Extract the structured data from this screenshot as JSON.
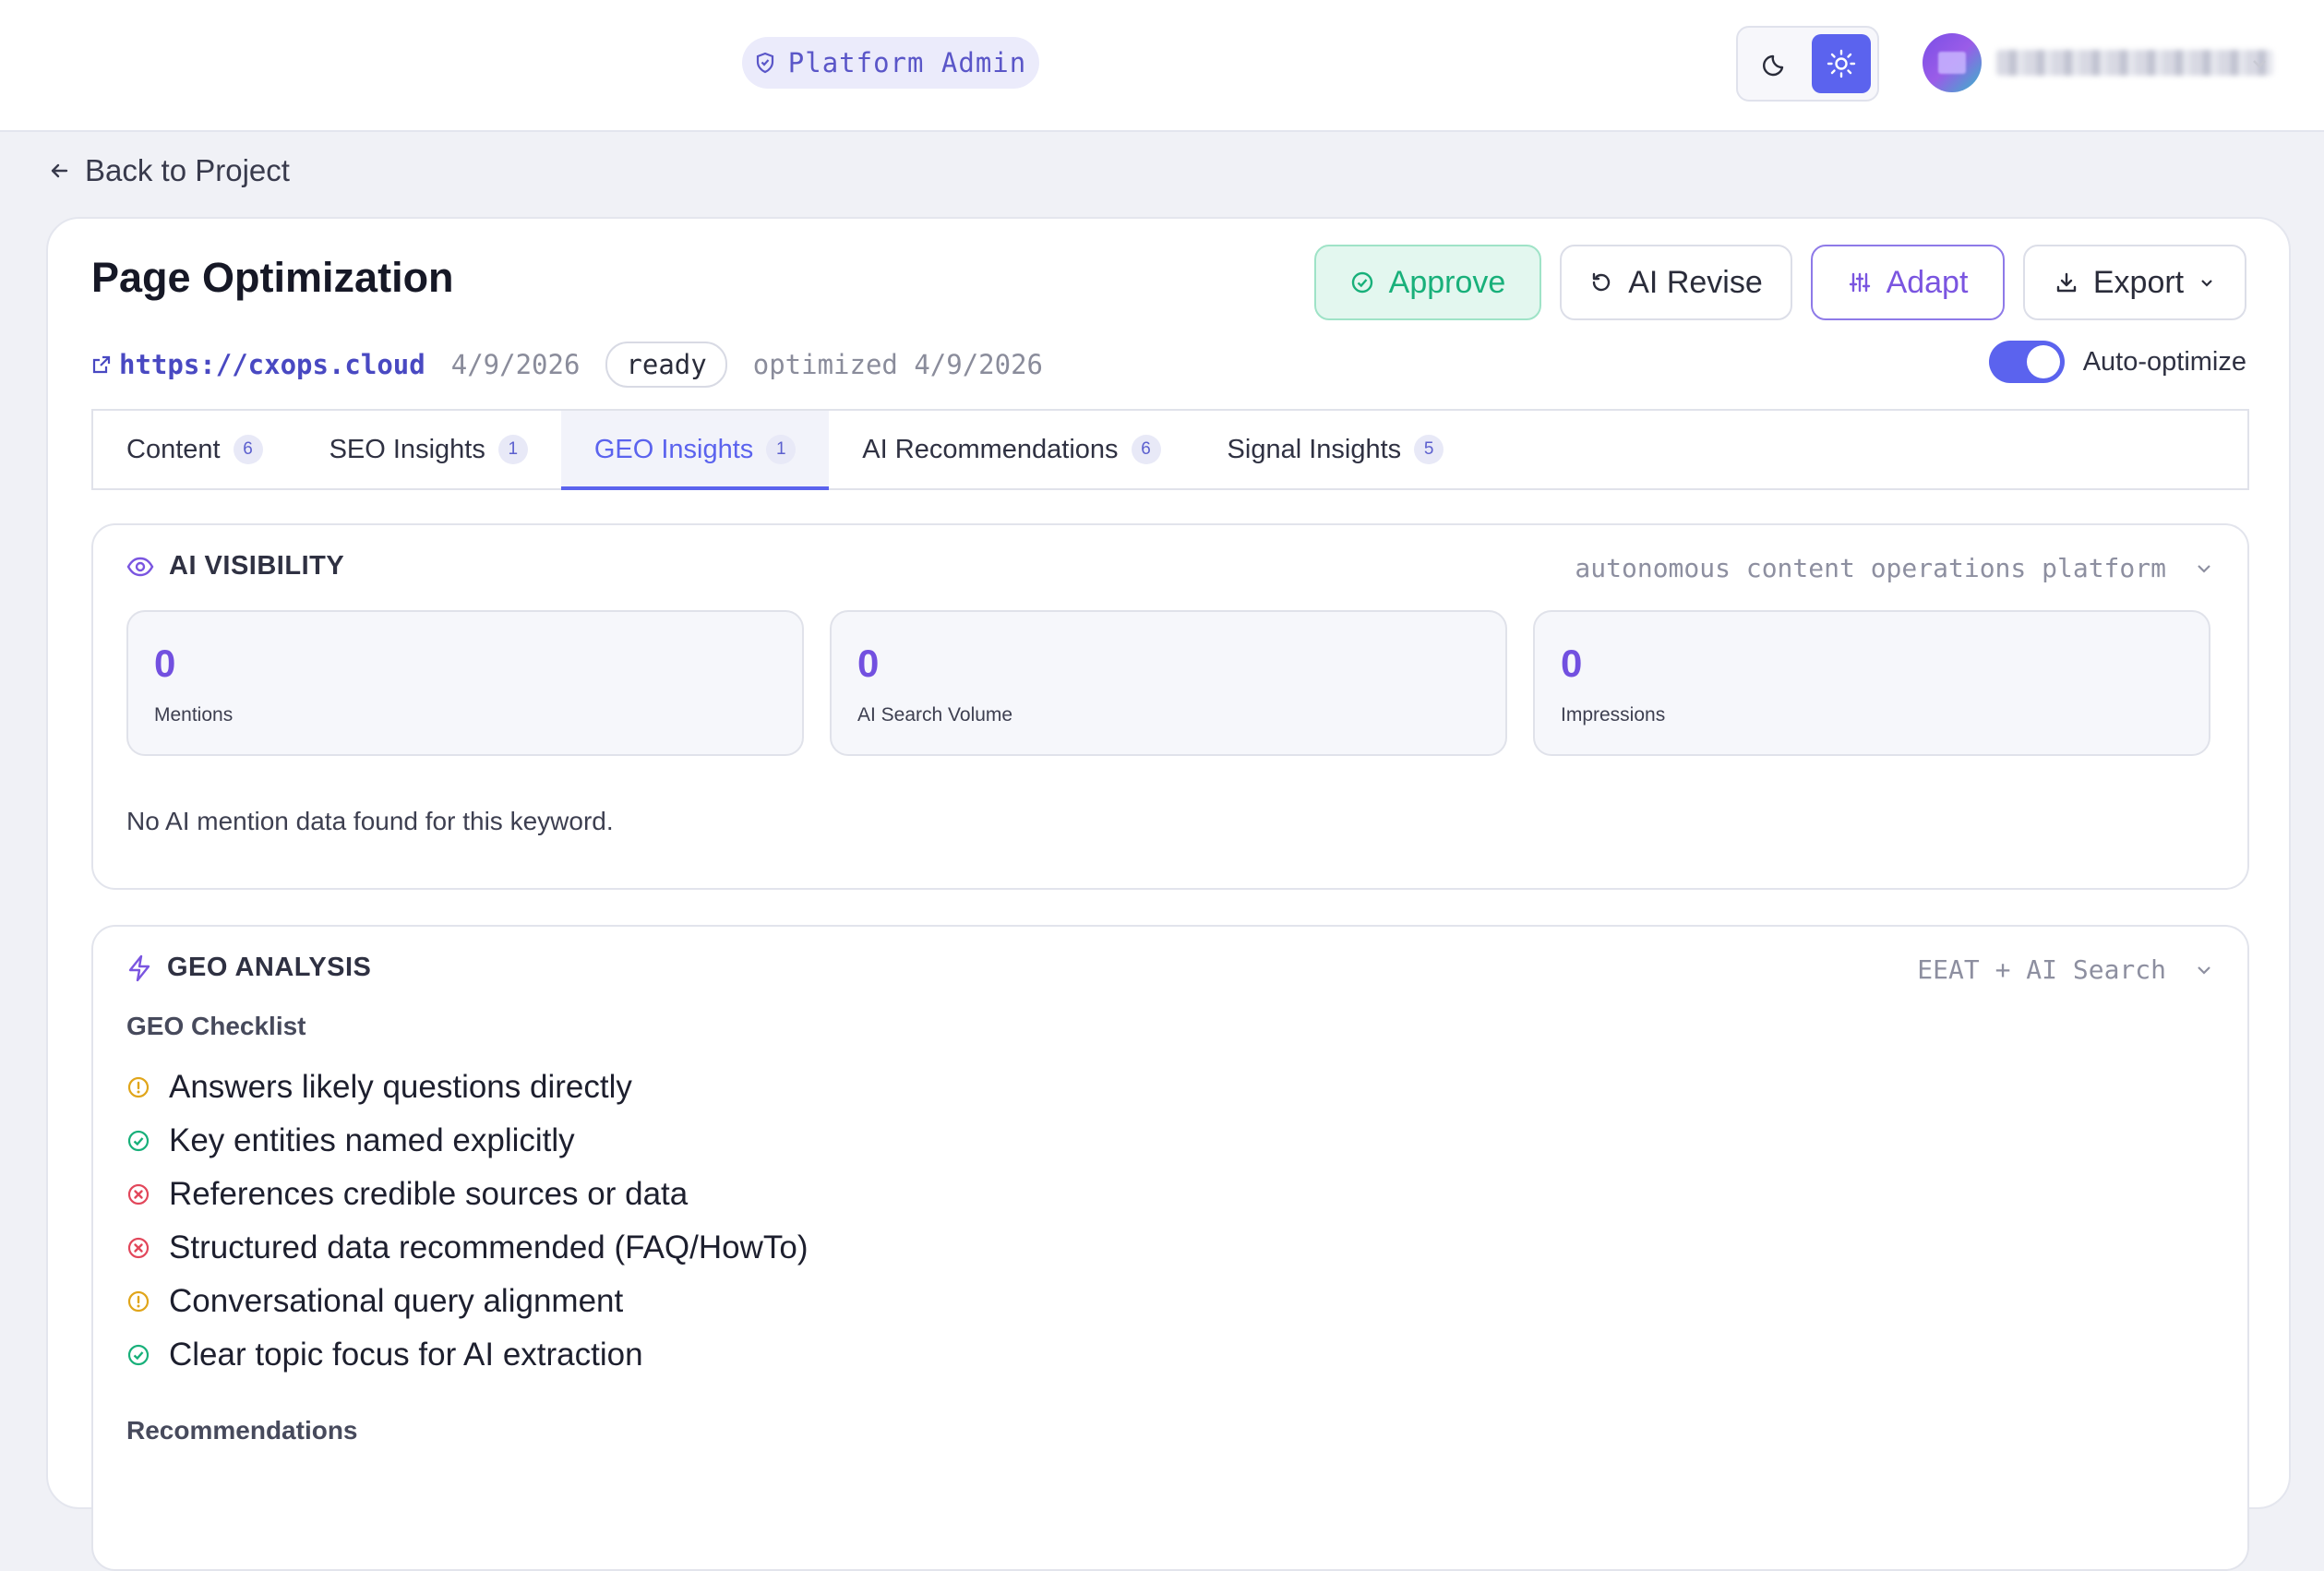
{
  "header": {
    "admin_label": "Platform Admin",
    "theme_options": [
      "dark",
      "light"
    ],
    "theme_active": "light",
    "user_name_redacted": true
  },
  "nav": {
    "back_label": "Back to Project"
  },
  "page": {
    "title": "Page Optimization",
    "url": "https://cxops.cloud",
    "date": "4/9/2026",
    "status": "ready",
    "optimized": "optimized 4/9/2026",
    "auto_optimize_label": "Auto-optimize",
    "auto_optimize_on": true
  },
  "actions": {
    "approve": "Approve",
    "revise": "AI Revise",
    "adapt": "Adapt",
    "export": "Export"
  },
  "tabs": [
    {
      "label": "Content",
      "count": "6"
    },
    {
      "label": "SEO Insights",
      "count": "1"
    },
    {
      "label": "GEO Insights",
      "count": "1",
      "active": true
    },
    {
      "label": "AI Recommendations",
      "count": "6"
    },
    {
      "label": "Signal Insights",
      "count": "5"
    }
  ],
  "visibility": {
    "heading": "AI VISIBILITY",
    "keyword": "autonomous content operations platform",
    "stats": [
      {
        "value": "0",
        "label": "Mentions"
      },
      {
        "value": "0",
        "label": "AI Search Volume"
      },
      {
        "value": "0",
        "label": "Impressions"
      }
    ],
    "empty_text": "No AI mention data found for this keyword."
  },
  "geo": {
    "heading": "GEO ANALYSIS",
    "hint": "EEAT + AI Search",
    "checklist_title": "GEO Checklist",
    "checklist": [
      {
        "text": "Answers likely questions directly",
        "status": "warning"
      },
      {
        "text": "Key entities named explicitly",
        "status": "pass"
      },
      {
        "text": "References credible sources or data",
        "status": "fail"
      },
      {
        "text": "Structured data recommended (FAQ/HowTo)",
        "status": "fail"
      },
      {
        "text": "Conversational query alignment",
        "status": "warning"
      },
      {
        "text": "Clear topic focus for AI extraction",
        "status": "pass"
      }
    ],
    "recommendations_title": "Recommendations"
  },
  "colors": {
    "accent": "#5b63ee",
    "purple": "#7250e0",
    "success": "#18b07a",
    "warning": "#e0a51a",
    "danger": "#e2475b"
  }
}
